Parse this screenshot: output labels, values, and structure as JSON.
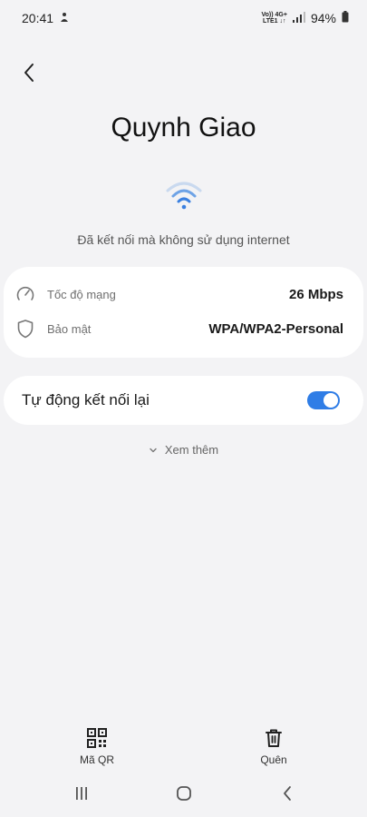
{
  "status_bar": {
    "time": "20:41",
    "network_top": "Vo)) 4G+",
    "network_bottom": "LTE1 ↓↑",
    "battery": "94%"
  },
  "header": {
    "back_icon": "chevron-left-icon",
    "network_name": "Quynh Giao"
  },
  "connection": {
    "icon": "wifi-icon",
    "status_text": "Đã kết nối mà không sử dụng internet"
  },
  "info": {
    "speed_label": "Tốc độ mạng",
    "speed_value": "26 Mbps",
    "security_label": "Bảo mật",
    "security_value": "WPA/WPA2-Personal"
  },
  "auto_reconnect": {
    "label": "Tự động kết nối lại",
    "enabled": true,
    "accent_color": "#2f7de6"
  },
  "see_more": {
    "label": "Xem thêm"
  },
  "actions": {
    "qr_label": "Mã QR",
    "forget_label": "Quên"
  },
  "nav": {
    "recents_icon": "recents-icon",
    "home_icon": "home-icon",
    "back_icon": "back-icon"
  }
}
